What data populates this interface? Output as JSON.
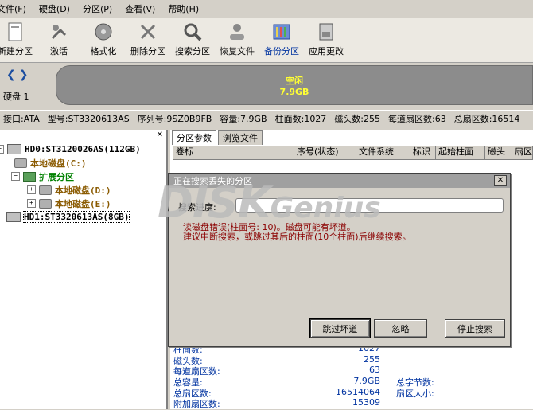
{
  "menu": [
    "文件(F)",
    "硬盘(D)",
    "分区(P)",
    "查看(V)",
    "帮助(H)"
  ],
  "toolbar": [
    {
      "label": "新建分区",
      "icon": "new-partition-icon"
    },
    {
      "label": "激活",
      "icon": "activate-icon"
    },
    {
      "label": "格式化",
      "icon": "format-icon"
    },
    {
      "label": "删除分区",
      "icon": "delete-partition-icon"
    },
    {
      "label": "搜索分区",
      "icon": "search-partition-icon"
    },
    {
      "label": "恢复文件",
      "icon": "recover-files-icon"
    },
    {
      "label": "备份分区",
      "icon": "backup-partition-icon"
    },
    {
      "label": "应用更改",
      "icon": "apply-changes-icon"
    }
  ],
  "disk": {
    "label": "硬盘 1",
    "partition_title": "空闲",
    "partition_size": "7.9GB"
  },
  "info": [
    "接口:ATA",
    "型号:ST3320613AS",
    "序列号:9SZ0B9FB",
    "容量:7.9GB",
    "柱面数:1027",
    "磁头数:255",
    "每道扇区数:63",
    "总扇区数:16514"
  ],
  "tree": {
    "hd0": "HD0:ST3120026AS(112GB)",
    "c": "本地磁盘(C:)",
    "ext": "扩展分区",
    "d": "本地磁盘(D:)",
    "e": "本地磁盘(E:)",
    "hd1": "HD1:ST3320613AS(8GB)"
  },
  "tabs": [
    "分区参数",
    "浏览文件"
  ],
  "columns": [
    "卷标",
    "序号(状态)",
    "文件系统",
    "标识",
    "起始柱面",
    "磁头",
    "扇区"
  ],
  "props": [
    {
      "label": "柱面数:",
      "value": "1027",
      "label2": ""
    },
    {
      "label": "磁头数:",
      "value": "255",
      "label2": ""
    },
    {
      "label": "每道扇区数:",
      "value": "63",
      "label2": ""
    },
    {
      "label": "总容量:",
      "value": "7.9GB",
      "label2": "总字节数:"
    },
    {
      "label": "总扇区数:",
      "value": "16514064",
      "label2": "扇区大小:"
    },
    {
      "label": "附加扇区数:",
      "value": "15309",
      "label2": ""
    }
  ],
  "watermark": {
    "main": "DISK",
    "sub": "Genius"
  },
  "dialog": {
    "title": "正在搜索丢失的分区",
    "progress_label": "搜索进度:",
    "progress": 0,
    "msg1": "读磁盘错误(柱面号: 10)。磁盘可能有坏道。",
    "msg2": "建议中断搜索，或跳过其后的柱面(10个柱面)后继续搜索。",
    "btn_skip": "跳过坏道",
    "btn_ignore": "忽略",
    "btn_stop": "停止搜索"
  }
}
